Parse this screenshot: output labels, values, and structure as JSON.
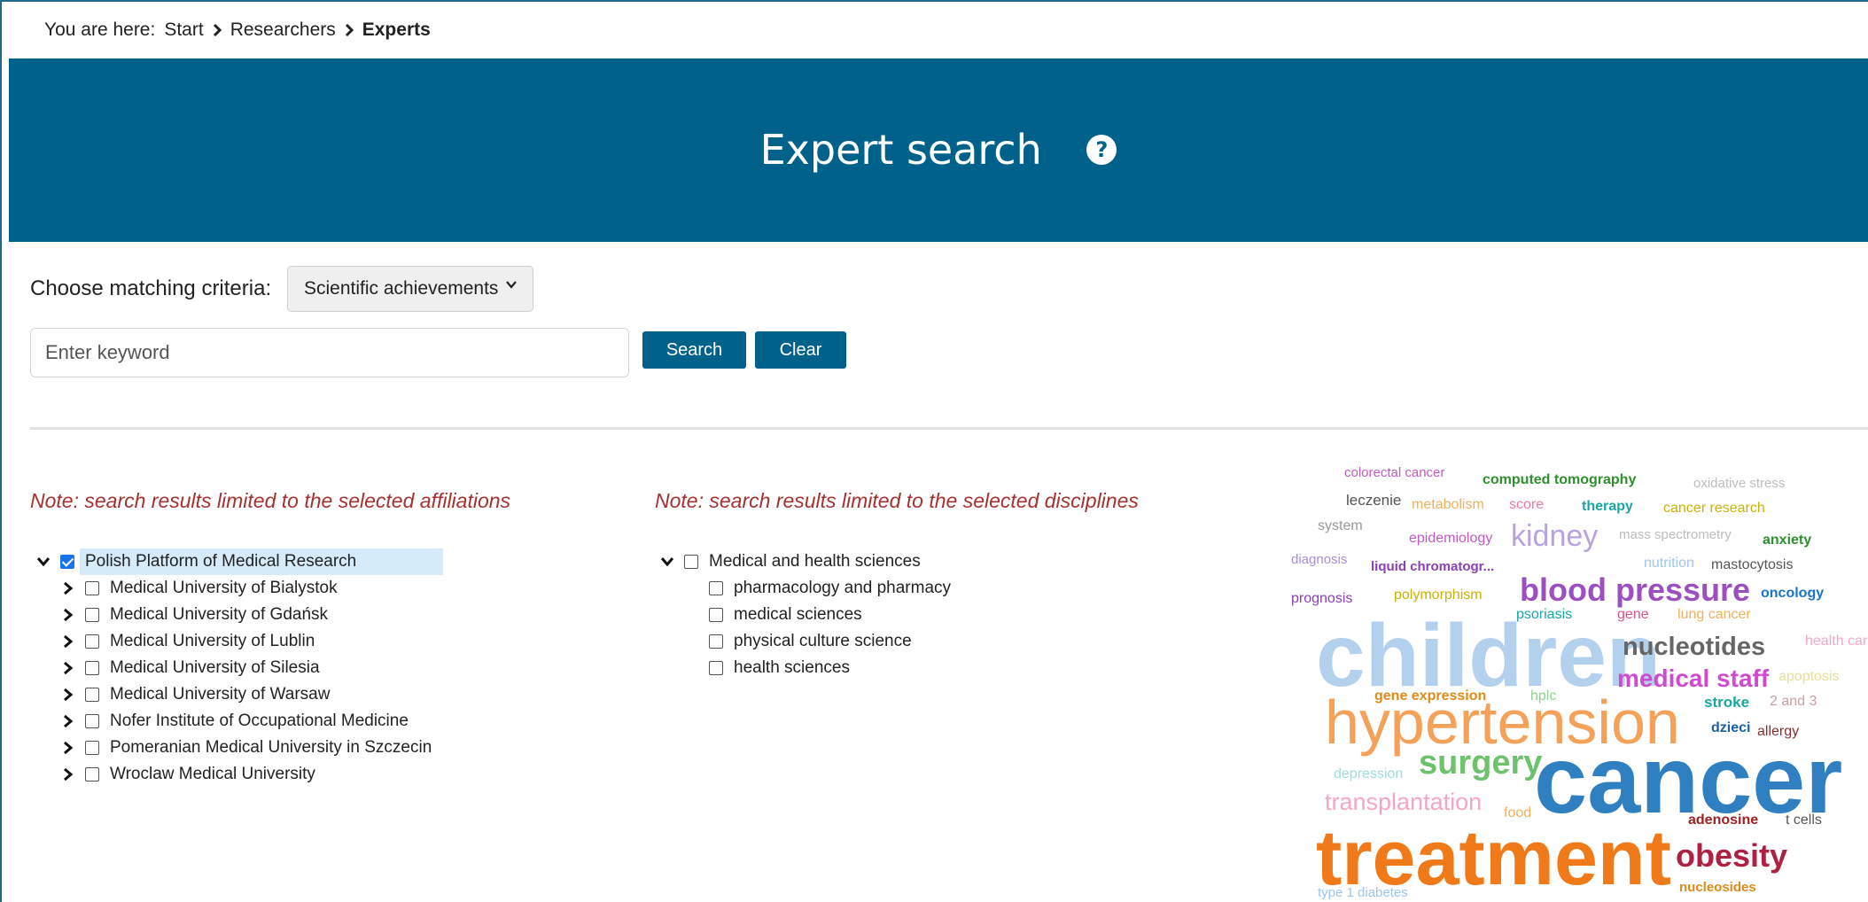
{
  "breadcrumb": {
    "prefix": "You are here:",
    "items": [
      "Start",
      "Researchers",
      "Experts"
    ]
  },
  "header": {
    "title": "Expert search",
    "help_icon": "question-circle-icon"
  },
  "criteria": {
    "label": "Choose matching criteria:",
    "selected": "Scientific achievements"
  },
  "search": {
    "placeholder": "Enter keyword",
    "value": "",
    "search_label": "Search",
    "clear_label": "Clear"
  },
  "affiliations": {
    "note": "Note: search results limited to the selected affiliations",
    "root": {
      "label": "Polish Platform of Medical Research",
      "checked": true,
      "expanded": true
    },
    "children": [
      "Medical University of Bialystok",
      "Medical University of Gdańsk",
      "Medical University of Lublin",
      "Medical University of Silesia",
      "Medical University of Warsaw",
      "Nofer Institute of Occupational Medicine",
      "Pomeranian Medical University in Szczecin",
      "Wroclaw Medical University"
    ]
  },
  "disciplines": {
    "note": "Note: search results limited to the selected disciplines",
    "root": {
      "label": "Medical and health sciences",
      "checked": false,
      "expanded": true
    },
    "children": [
      "pharmacology and pharmacy",
      "medical sciences",
      "physical culture science",
      "health sciences"
    ]
  },
  "word_cloud": [
    {
      "text": "colorectal cancer",
      "color": "#c15bc1"
    },
    {
      "text": "computed tomography",
      "color": "#2f8f2f"
    },
    {
      "text": "oxidative stress",
      "color": "#bdbdbd"
    },
    {
      "text": "leczenie",
      "color": "#555555"
    },
    {
      "text": "metabolism",
      "color": "#f0b060"
    },
    {
      "text": "score",
      "color": "#e97aa7"
    },
    {
      "text": "therapy",
      "color": "#1aa6a6"
    },
    {
      "text": "cancer research",
      "color": "#c9b200"
    },
    {
      "text": "system",
      "color": "#999999"
    },
    {
      "text": "epidemiology",
      "color": "#c15bc1"
    },
    {
      "text": "kidney",
      "color": "#b8a3e0"
    },
    {
      "text": "mass spectrometry",
      "color": "#bdbdbd"
    },
    {
      "text": "anxiety",
      "color": "#2f8f2f"
    },
    {
      "text": "diagnosis",
      "color": "#a98fd9"
    },
    {
      "text": "liquid chromatogr...",
      "color": "#8a3fb3"
    },
    {
      "text": "nutrition",
      "color": "#9fc5e8"
    },
    {
      "text": "mastocytosis",
      "color": "#555555"
    },
    {
      "text": "prognosis",
      "color": "#8a3fb3"
    },
    {
      "text": "polymorphism",
      "color": "#c9b200"
    },
    {
      "text": "blood pressure",
      "color": "#9c4fc0"
    },
    {
      "text": "oncology",
      "color": "#1a73c9"
    },
    {
      "text": "psoriasis",
      "color": "#1aa6a6"
    },
    {
      "text": "gene",
      "color": "#e0508a"
    },
    {
      "text": "lung cancer",
      "color": "#f0b060"
    },
    {
      "text": "children",
      "color": "#b3d1ed"
    },
    {
      "text": "nucleotides",
      "color": "#666666"
    },
    {
      "text": "health care",
      "color": "#f4a6c6"
    },
    {
      "text": "medical staff",
      "color": "#d04ad0"
    },
    {
      "text": "apoptosis",
      "color": "#e6df9a"
    },
    {
      "text": "gene expression",
      "color": "#e08a1a"
    },
    {
      "text": "hplc",
      "color": "#8fd48f"
    },
    {
      "text": "stroke",
      "color": "#1aa6a6"
    },
    {
      "text": "2 and 3",
      "color": "#c9a0a0"
    },
    {
      "text": "hypertension",
      "color": "#f4a15a"
    },
    {
      "text": "dzieci",
      "color": "#1a5fa6"
    },
    {
      "text": "allergy",
      "color": "#8a2f2f"
    },
    {
      "text": "depression",
      "color": "#9fdcdc"
    },
    {
      "text": "surgery",
      "color": "#6ec26e"
    },
    {
      "text": "cancer",
      "color": "#2f7fc1"
    },
    {
      "text": "transplantation",
      "color": "#f4a6c6"
    },
    {
      "text": "food",
      "color": "#f0b060"
    },
    {
      "text": "adenosine",
      "color": "#a02020"
    },
    {
      "text": "t cells",
      "color": "#555555"
    },
    {
      "text": "treatment",
      "color": "#f07a1a"
    },
    {
      "text": "obesity",
      "color": "#b02040"
    },
    {
      "text": "type 1 diabetes",
      "color": "#9fc5e8"
    },
    {
      "text": "nucleosides",
      "color": "#e08a1a"
    }
  ]
}
